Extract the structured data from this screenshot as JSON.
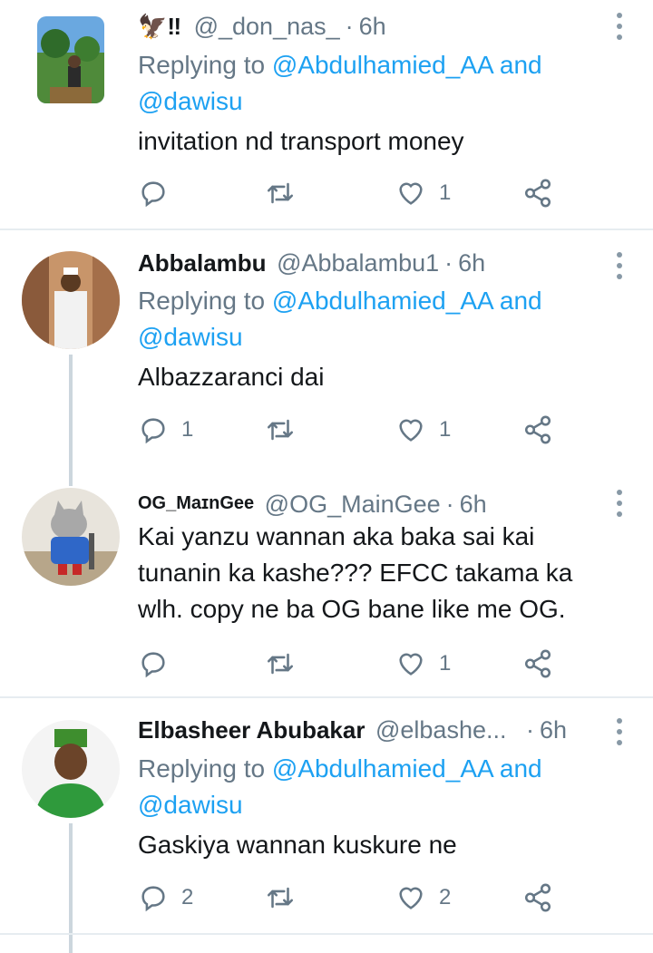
{
  "tweets": [
    {
      "user_emoji": "🦅‼",
      "display_name": "",
      "handle": "@_don_nas_",
      "time": "6h",
      "replying_prefix": "Replying to",
      "replying_user1": "@Abdulhamied_AA",
      "replying_and": "and",
      "replying_user2": "@dawisu",
      "text": "invitation nd transport money",
      "reply_count": "",
      "retweet_count": "",
      "like_count": "1"
    },
    {
      "display_name": "Abbalambu",
      "handle": "@Abbalambu1",
      "time": "6h",
      "replying_prefix": "Replying to",
      "replying_user1": "@Abdulhamied_AA",
      "replying_and": "and",
      "replying_user2": "@dawisu",
      "text": "Albazzaranci dai",
      "reply_count": "1",
      "retweet_count": "",
      "like_count": "1"
    },
    {
      "display_name": "OG_MaɪnGee",
      "handle": "@OG_MainGee",
      "time": "6h",
      "text_line1": "Kai yanzu wannan aka baka sai kai",
      "text_line2": "tunanin ka kashe??? EFCC takama ka",
      "text_line3": "wlh. copy ne ba OG bane like me OG.",
      "reply_count": "",
      "retweet_count": "",
      "like_count": "1"
    },
    {
      "display_name": "Elbasheer Abubakar",
      "handle": "@elbashe...",
      "time": "6h",
      "replying_prefix": "Replying to",
      "replying_user1": "@Abdulhamied_AA",
      "replying_and": "and",
      "replying_user2": "@dawisu",
      "text": "Gaskiya wannan kuskure ne",
      "reply_count": "2",
      "retweet_count": "",
      "like_count": "2"
    }
  ],
  "icons": {
    "reply": "reply-icon",
    "retweet": "retweet-icon",
    "like": "heart-icon",
    "share": "share-icon",
    "more": "more-options-icon"
  },
  "colors": {
    "link": "#1da1f2",
    "secondary": "#657786",
    "separator": "#e6ecf0"
  }
}
